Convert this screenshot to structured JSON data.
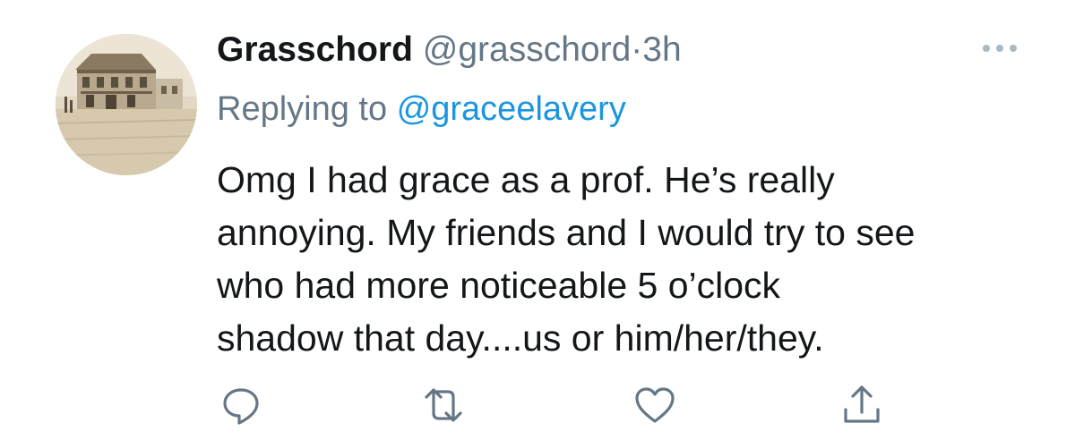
{
  "tweet": {
    "display_name": "Grasschord",
    "handle": "@grasschord",
    "separator": "·",
    "time": "3h",
    "replying_prefix": "Replying to",
    "replying_to": "@graceelavery",
    "text": "Omg I had grace as a prof. He’s really\nannoying. My friends and I would try to see\nwho had more noticeable 5 o’clock\nshadow that day....us or him/her/they."
  },
  "icons": {
    "more": "more-dots-icon",
    "reply": "reply-icon",
    "retweet": "retweet-icon",
    "like": "like-icon",
    "share": "share-icon"
  },
  "colors": {
    "text_primary": "#14171a",
    "text_secondary": "#657786",
    "link": "#1b95e0",
    "icon": "#657786"
  }
}
